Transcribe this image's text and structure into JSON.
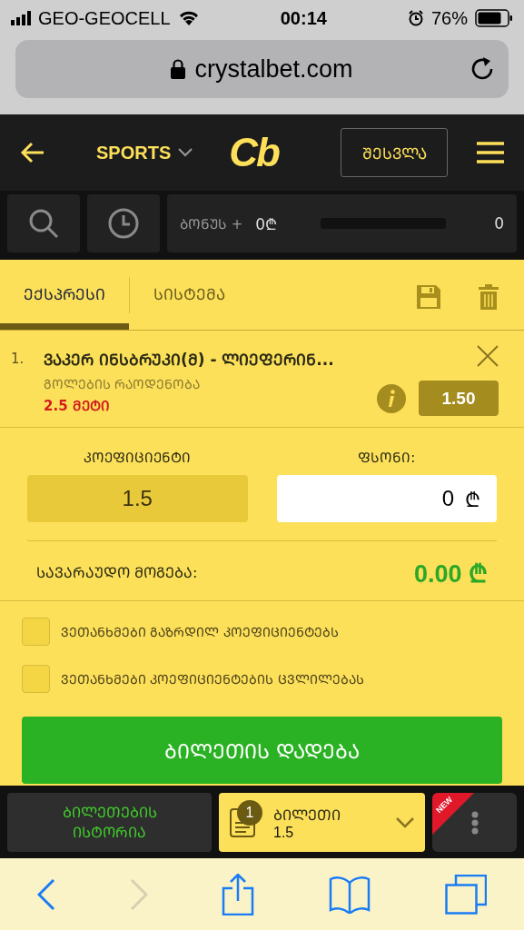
{
  "status_bar": {
    "carrier": "GEO-GEOCELL",
    "time": "00:14",
    "battery": "76%"
  },
  "address_bar": {
    "url": "crystalbet.com"
  },
  "header": {
    "menu_label": "SPORTS",
    "logo": "Cb",
    "login": "ᲨᲔᲡᲕᲚᲐ"
  },
  "bonus": {
    "label": "ᲑᲝᲜᲣᲡ +",
    "amount": "0₾",
    "level": 0,
    "count": "0"
  },
  "tabs": [
    {
      "label": "ᲔᲥᲡᲞᲠᲔᲡᲘ",
      "selected": true
    },
    {
      "label": "ᲡᲘᲡᲢᲔᲛᲐ",
      "selected": false
    }
  ],
  "bets": [
    {
      "number": "1.",
      "match": "ᲕᲐᲙᲔᲠ ᲘᲜᲡᲑᲠᲣᲙᲘ(Მ) - ᲚᲘᲔᲤᲔᲠᲘᲜ...",
      "market": "ᲒᲝᲚᲔᲑᲘᲡ ᲠᲐᲝᲓᲔᲜᲝᲑᲐ",
      "outcome": "2.5 ᲛᲔᲢᲘ",
      "odds": "1.50"
    }
  ],
  "stake": {
    "odds_label": "ᲙᲝᲔᲤᲘᲪᲘᲔᲜᲢᲘ",
    "odds_value": "1.5",
    "stake_label": "ᲤᲡᲝᲜᲘ:",
    "stake_value": "0",
    "currency": "₾",
    "win_label": "ᲡᲐᲕᲐᲠᲐᲣᲓᲝ ᲛᲝᲒᲔᲑᲐ:",
    "win_value": "0.00 ₾"
  },
  "agreements": [
    {
      "label": "ᲕᲔᲗᲐᲜᲮᲛᲔᲑᲘ ᲒᲐᲖᲠᲓᲘᲚ ᲙᲝᲔᲤᲘᲪᲘᲔᲜᲢᲔᲑᲡ",
      "checked": false
    },
    {
      "label": "ᲕᲔᲗᲐᲜᲮᲛᲔᲑᲘ ᲙᲝᲔᲤᲘᲪᲘᲔᲜᲢᲔᲑᲘᲡ ᲪᲕᲚᲘᲚᲔᲑᲐᲡ",
      "checked": false
    }
  ],
  "place_bet": "ᲑᲘᲚᲔᲗᲘᲡ ᲓᲐᲓᲔᲑᲐ",
  "bottom_bar": {
    "history": "ᲑᲘᲚᲔᲗᲔᲑᲘᲡ ᲘᲡᲢᲝᲠᲘᲐ",
    "slip_count": "1",
    "slip_label": "ᲑᲘᲚᲔᲗᲘ",
    "slip_odds": "1.5",
    "new_badge": "NEW"
  }
}
